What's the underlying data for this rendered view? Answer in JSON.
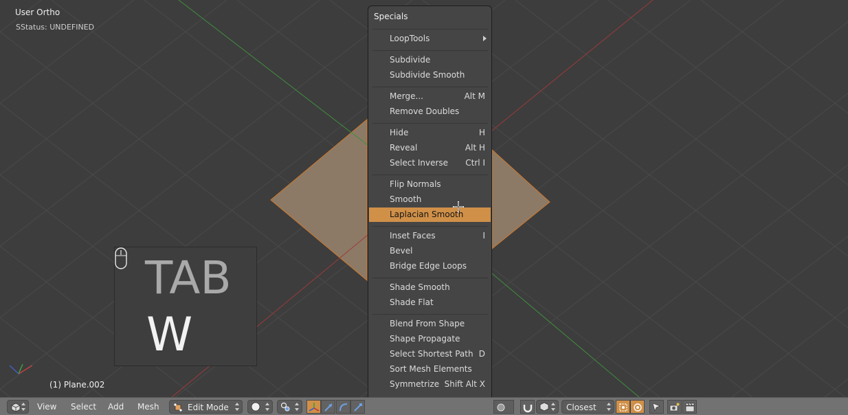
{
  "viewport": {
    "view_title": "User Ortho",
    "status": "SStatus: UNDEFINED",
    "object_name": "(1) Plane.002"
  },
  "screencast_keys": {
    "key_main": "TAB",
    "key_secondary": "W",
    "mouse_icon": "mouse-icon"
  },
  "menu": {
    "title": "Specials",
    "items": [
      {
        "label": "LoopTools",
        "shortcut": "",
        "submenu": true
      },
      {
        "label": "Subdivide",
        "shortcut": ""
      },
      {
        "label": "Subdivide Smooth",
        "shortcut": ""
      },
      {
        "label": "Merge...",
        "shortcut": "Alt M"
      },
      {
        "label": "Remove Doubles",
        "shortcut": ""
      },
      {
        "label": "Hide",
        "shortcut": "H"
      },
      {
        "label": "Reveal",
        "shortcut": "Alt H"
      },
      {
        "label": "Select Inverse",
        "shortcut": "Ctrl I"
      },
      {
        "label": "Flip Normals",
        "shortcut": ""
      },
      {
        "label": "Smooth",
        "shortcut": ""
      },
      {
        "label": "Laplacian Smooth",
        "shortcut": "",
        "highlighted": true
      },
      {
        "label": "Inset Faces",
        "shortcut": "I"
      },
      {
        "label": "Bevel",
        "shortcut": ""
      },
      {
        "label": "Bridge Edge Loops",
        "shortcut": ""
      },
      {
        "label": "Shade Smooth",
        "shortcut": ""
      },
      {
        "label": "Shade Flat",
        "shortcut": ""
      },
      {
        "label": "Blend From Shape",
        "shortcut": ""
      },
      {
        "label": "Shape Propagate",
        "shortcut": ""
      },
      {
        "label": "Select Shortest Path",
        "shortcut": "D"
      },
      {
        "label": "Sort Mesh Elements",
        "shortcut": ""
      },
      {
        "label": "Symmetrize",
        "shortcut": "Shift Alt X"
      }
    ]
  },
  "header": {
    "menus": {
      "view": "View",
      "select": "Select",
      "add": "Add",
      "mesh": "Mesh"
    },
    "mode": "Edit Mode",
    "snap_target": "Closest"
  },
  "colors": {
    "background": "#3d3d3d",
    "menu_bg": "#454545",
    "highlight": "#d09048",
    "face_fill": "#8c7a66",
    "header": "#727272",
    "axis_x": "#9e3a3a",
    "axis_y": "#3f8f3f"
  }
}
